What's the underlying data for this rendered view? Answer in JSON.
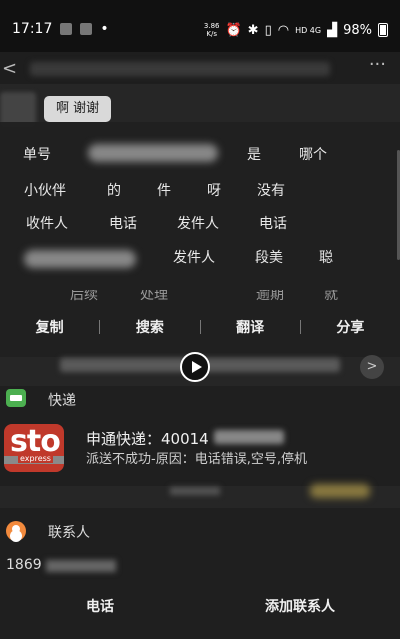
{
  "status_bar": {
    "time": "17:17",
    "net_speed_value": "3.86",
    "net_speed_unit": "K/s",
    "network": "HD 4G",
    "battery": "98%"
  },
  "chat": {
    "bubble_text": "啊 谢谢"
  },
  "word_chips": [
    "单号",
    "是",
    "哪个",
    "小伙伴",
    "的",
    "件",
    "呀",
    "没有",
    "收件人",
    "电话",
    "发件人",
    "电话",
    "发件人",
    "段美",
    "聪"
  ],
  "partial_words": [
    "后续",
    "处理",
    "逾期",
    "就"
  ],
  "actions": [
    "复制",
    "搜索",
    "翻译",
    "分享"
  ],
  "express": {
    "section_title": "快递",
    "logo_text": "sto",
    "logo_sub": "express",
    "tracking_prefix": "申通快递：40014",
    "message": "派送不成功-原因：电话错误,空号,停机"
  },
  "contact": {
    "section_title": "联系人",
    "phone_prefix": "1869"
  },
  "bottom_buttons": {
    "call": "电话",
    "add_contact": "添加联系人"
  }
}
